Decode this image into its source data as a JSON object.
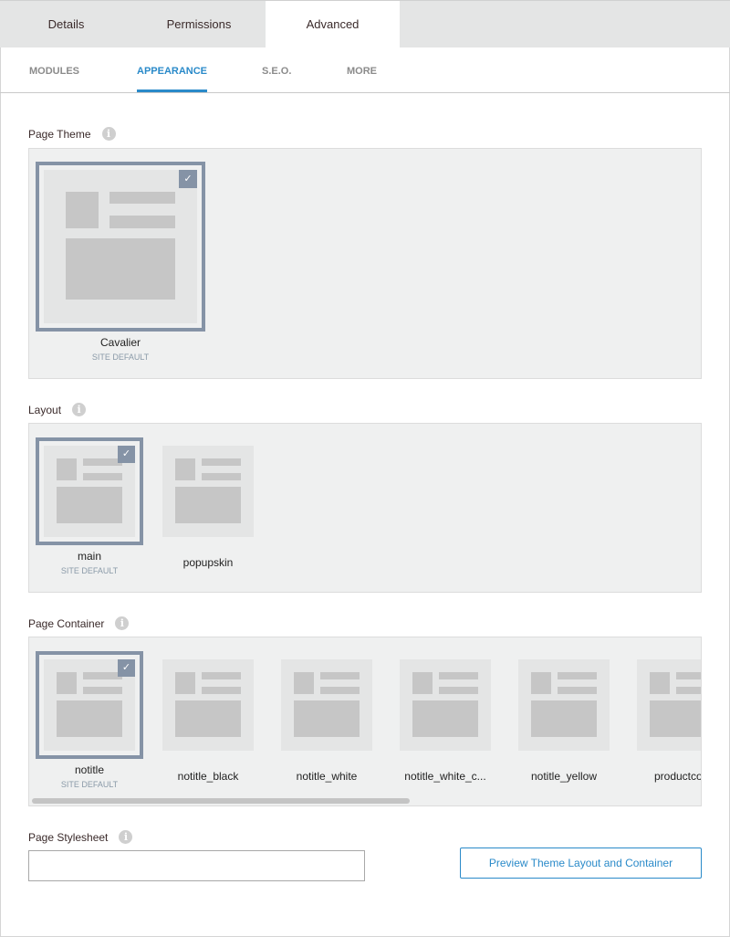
{
  "tabs": [
    {
      "label": "Details"
    },
    {
      "label": "Permissions"
    },
    {
      "label": "Advanced",
      "active": true
    }
  ],
  "subtabs": [
    {
      "label": "MODULES"
    },
    {
      "label": "APPEARANCE",
      "active": true
    },
    {
      "label": "S.E.O."
    },
    {
      "label": "MORE"
    }
  ],
  "theme": {
    "label": "Page Theme",
    "items": [
      {
        "name": "Cavalier",
        "default": "SITE DEFAULT",
        "selected": true
      }
    ]
  },
  "layout": {
    "label": "Layout",
    "items": [
      {
        "name": "main",
        "default": "SITE DEFAULT",
        "selected": true
      },
      {
        "name": "popupskin"
      }
    ]
  },
  "container": {
    "label": "Page Container",
    "items": [
      {
        "name": "notitle",
        "default": "SITE DEFAULT",
        "selected": true
      },
      {
        "name": "notitle_black"
      },
      {
        "name": "notitle_white"
      },
      {
        "name": "notitle_white_c..."
      },
      {
        "name": "notitle_yellow"
      },
      {
        "name": "productcolu"
      }
    ]
  },
  "stylesheet": {
    "label": "Page Stylesheet",
    "value": ""
  },
  "preview_button": "Preview Theme Layout and Container",
  "icons": {
    "info": "info-icon",
    "check": "check-icon"
  },
  "colors": {
    "accent": "#2a8ac9",
    "selected_border": "#8593a6"
  }
}
